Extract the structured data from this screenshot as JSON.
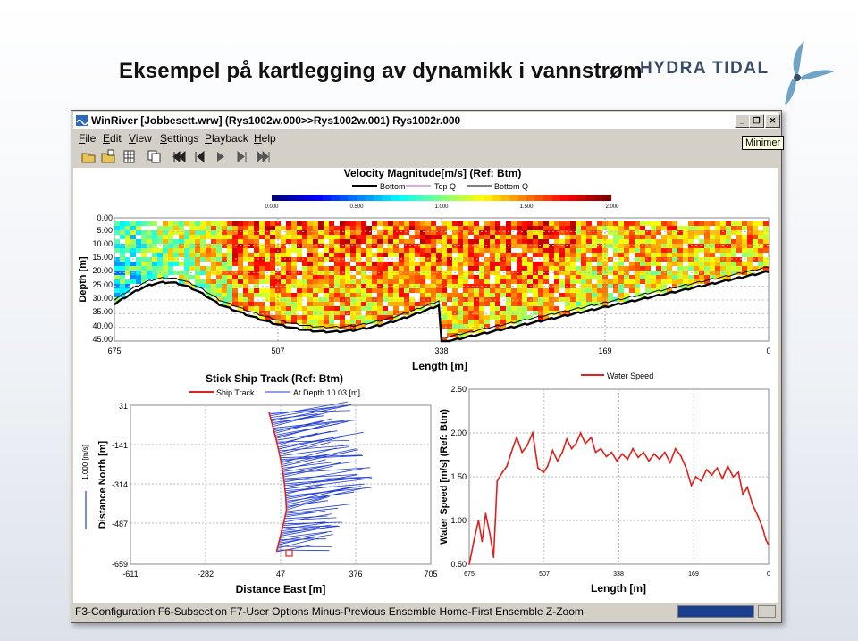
{
  "slide": {
    "title": "Eksempel på kartlegging av dynamikk i vannstrøm",
    "logo_text": "HYDRA TIDAL"
  },
  "window": {
    "title": "WinRiver  [Jobbesett.wrw] (Rys1002w.000>>Rys1002w.001) Rys1002r.000",
    "tooltip": "Minimer",
    "menu": [
      "File",
      "Edit",
      "View",
      "Settings",
      "Playback",
      "Help"
    ],
    "toolbar_icons": [
      "open-folder-icon",
      "open-file-icon",
      "grid-icon",
      "copy-icon",
      "first-icon",
      "previous-icon",
      "next-icon",
      "next-marker-icon",
      "last-icon"
    ],
    "status": "F3-Configuration  F6-Subsection  F7-User Options  Minus-Previous Ensemble  Home-First Ensemble  Z-Zoom"
  },
  "colors": {
    "title_bar": "#ffffff",
    "logo_blue": "#3a4d66",
    "logo_teal": "#6fa4c4",
    "ship_track": "#e0201b",
    "depth_track": "#1f3bd8",
    "water_speed": "#e0201b",
    "status_indicator": "#1b3f8f"
  },
  "velocity_plot": {
    "title": "Velocity Magnitude[m/s] (Ref: Btm)",
    "legend": [
      "Bottom",
      "Top Q",
      "Bottom Q"
    ],
    "scale_ticks": [
      "0.000",
      "0.500",
      "1.000",
      "1.500",
      "2.000"
    ],
    "y_axis_label": "Depth [m]",
    "y_ticks": [
      "0.00",
      "5.00",
      "10.00",
      "15.00",
      "20.00",
      "25.00",
      "30.00",
      "35.00",
      "40.00",
      "45.00"
    ],
    "x_axis_label": "Length [m]",
    "x_ticks": [
      "675",
      "507",
      "338",
      "169",
      "0"
    ]
  },
  "ship_track_plot": {
    "title": "Stick Ship Track (Ref: Btm)",
    "legend": [
      "Ship Track",
      "At Depth 10.03 [m]"
    ],
    "x_axis_label": "Distance East [m]",
    "y_axis_label": "Distance North [m]",
    "scale_label": "1.000 [m/s]",
    "x_ticks": [
      "-611",
      "-282",
      "47",
      "376",
      "705"
    ],
    "y_ticks": [
      "31",
      "-141",
      "-314",
      "-487",
      "-659"
    ]
  },
  "chart_data": {
    "type": "line",
    "title": "",
    "legend": "Water Speed",
    "xlabel": "Length [m]",
    "ylabel": "Water Speed [m/s] (Ref: Btm)",
    "x_ticks": [
      "675",
      "507",
      "338",
      "169",
      "0"
    ],
    "y_ticks": [
      "0.50",
      "1.00",
      "1.50",
      "2.00",
      "2.50"
    ],
    "xlim": [
      675,
      0
    ],
    "ylim": [
      0.5,
      2.5
    ],
    "grid": true,
    "series": [
      {
        "name": "Water Speed",
        "x": [
          675,
          664,
          654,
          646,
          638,
          628,
          620,
          612,
          600,
          590,
          580,
          568,
          556,
          545,
          532,
          520,
          507,
          498,
          487,
          476,
          465,
          455,
          444,
          434,
          424,
          413,
          400,
          390,
          378,
          366,
          354,
          342,
          330,
          318,
          306,
          294,
          282,
          270,
          258,
          246,
          234,
          222,
          210,
          198,
          186,
          174,
          164,
          152,
          140,
          128,
          116,
          104,
          92,
          80,
          68,
          58,
          48,
          36,
          24,
          14,
          6,
          0
        ],
        "values": [
          0.5,
          0.78,
          1.0,
          0.76,
          1.08,
          0.84,
          0.58,
          1.45,
          1.55,
          1.62,
          1.78,
          1.95,
          1.78,
          1.85,
          2.0,
          1.6,
          1.55,
          1.62,
          1.8,
          1.68,
          1.78,
          1.93,
          1.82,
          1.88,
          2.0,
          1.88,
          1.95,
          1.78,
          1.82,
          1.73,
          1.78,
          1.68,
          1.76,
          1.7,
          1.82,
          1.72,
          1.78,
          1.68,
          1.76,
          1.7,
          1.78,
          1.66,
          1.82,
          1.74,
          1.6,
          1.4,
          1.5,
          1.45,
          1.58,
          1.52,
          1.6,
          1.48,
          1.62,
          1.5,
          1.55,
          1.3,
          1.38,
          1.18,
          1.05,
          0.92,
          0.78,
          0.72
        ]
      }
    ]
  }
}
